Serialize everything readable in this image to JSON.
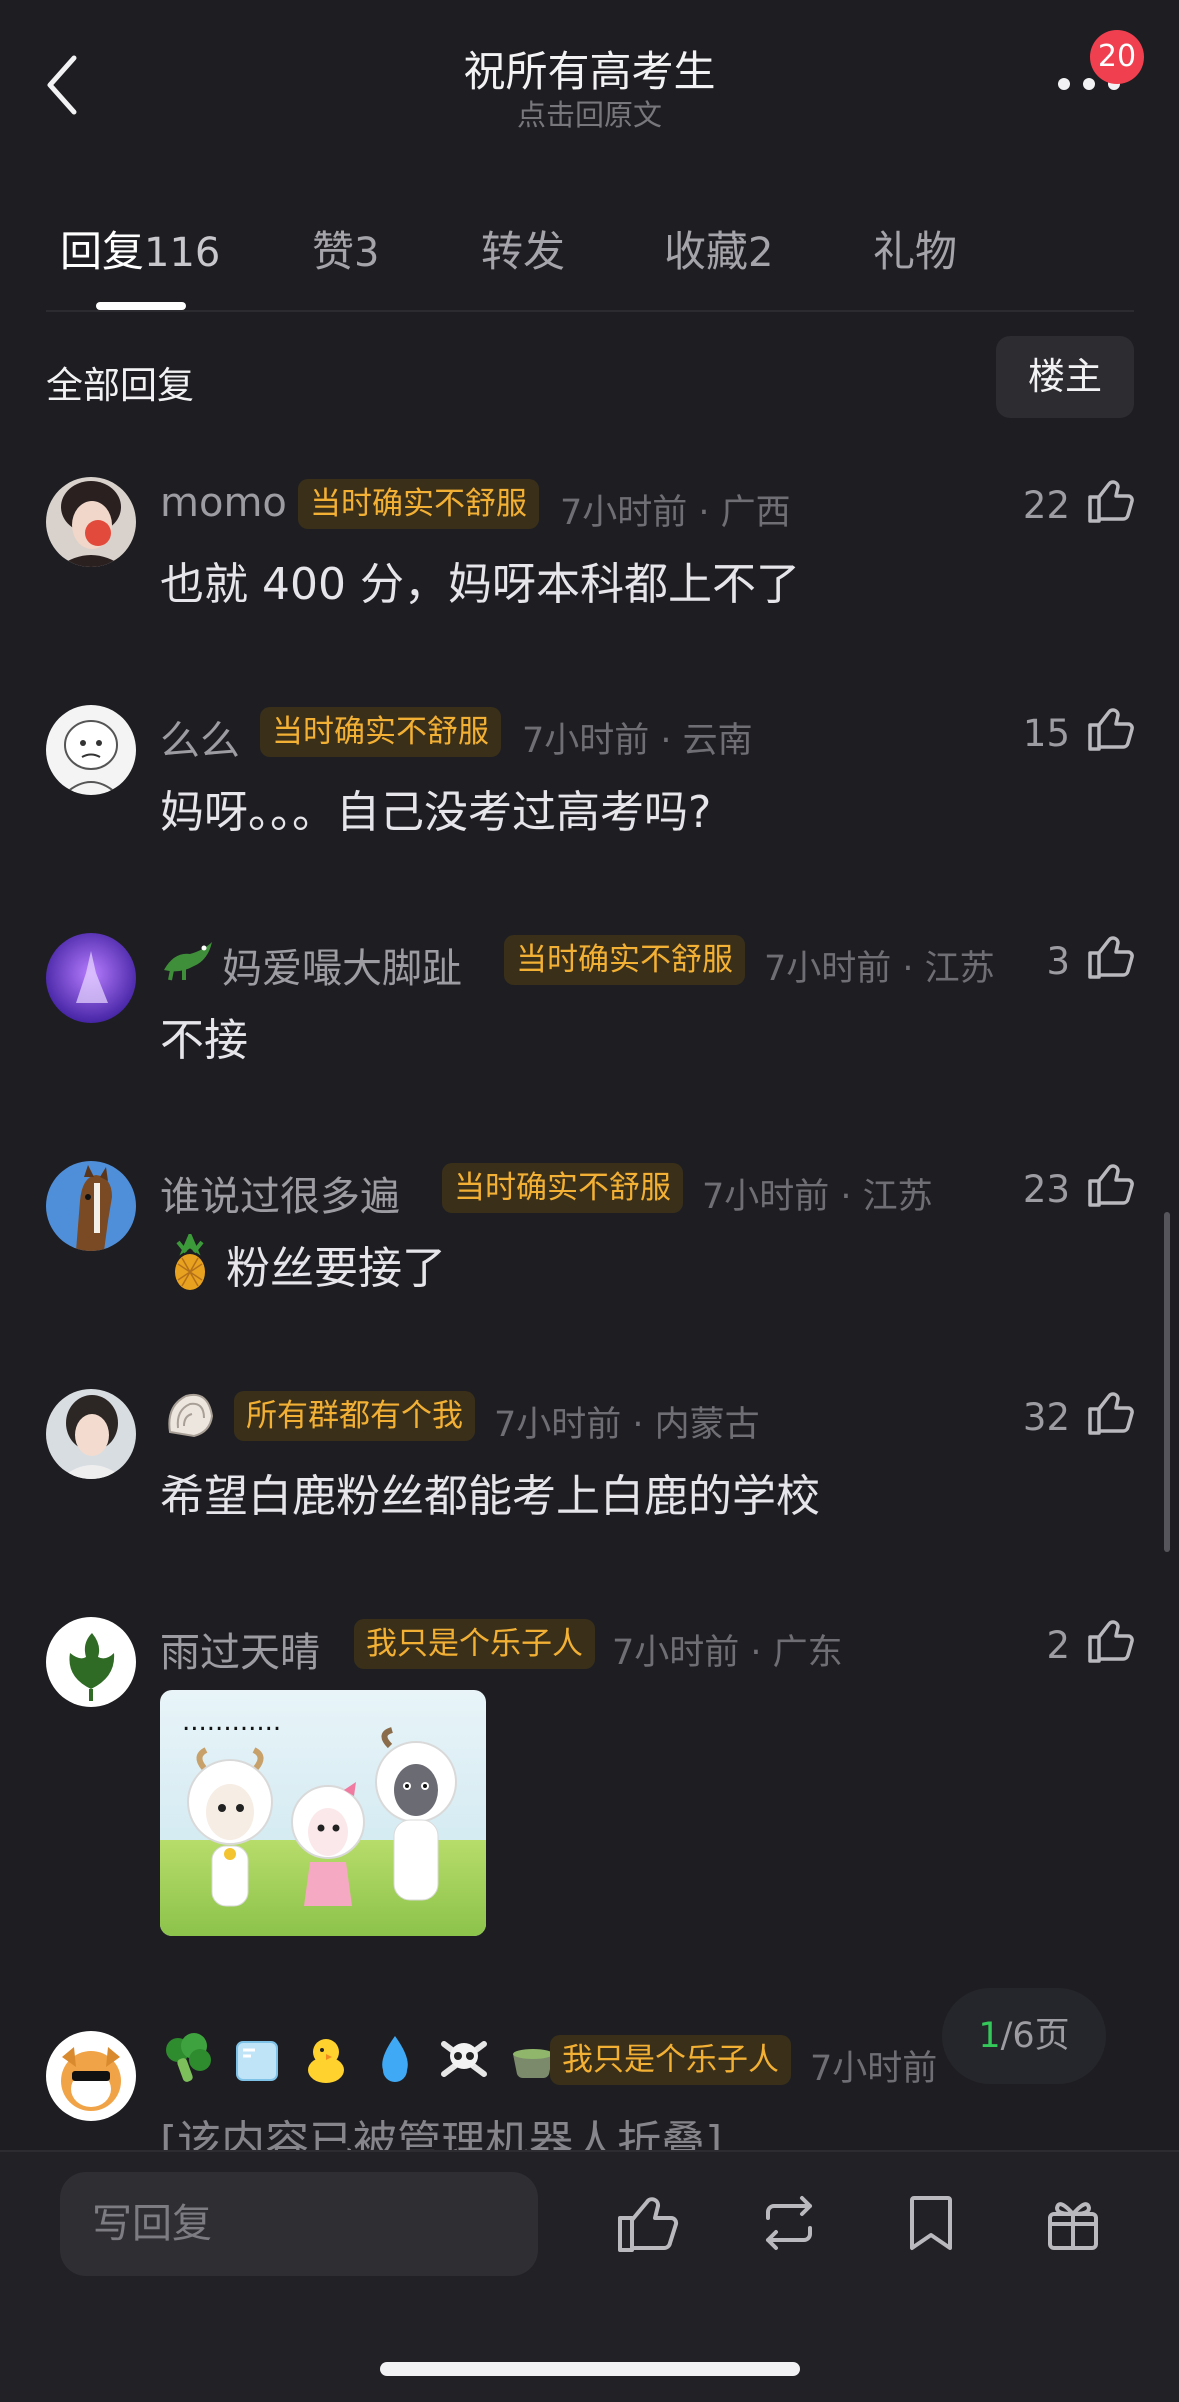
{
  "header": {
    "title": "祝所有高考生",
    "subtitle": "点击回原文",
    "badge_count": "20"
  },
  "tabs": [
    {
      "label": "回复",
      "count": "116",
      "active": true
    },
    {
      "label": "赞",
      "count": "3"
    },
    {
      "label": "转发",
      "count": ""
    },
    {
      "label": "收藏",
      "count": "2"
    },
    {
      "label": "礼物",
      "count": ""
    }
  ],
  "section": {
    "title": "全部回复",
    "filter": "楼主"
  },
  "comments": [
    {
      "username": "momo",
      "tag": "当时确实不舒服",
      "time": "7小时前 · 广西",
      "likes": "22",
      "text": "也就 400 分，妈呀本科都上不了"
    },
    {
      "username": "么么",
      "tag": "当时确实不舒服",
      "time": "7小时前 · 云南",
      "likes": "15",
      "text": "妈呀。。。自己没考过高考吗?"
    },
    {
      "username": "妈爱嘬大脚趾",
      "tag": "当时确实不舒服",
      "time": "7小时前 · 江苏",
      "likes": "3",
      "text": "不接"
    },
    {
      "username": "谁说过很多遍",
      "tag": "当时确实不舒服",
      "time": "7小时前 · 江苏",
      "likes": "23",
      "text": "粉丝要接了"
    },
    {
      "username": "",
      "tag": "所有群都有个我",
      "time": "7小时前 · 内蒙古",
      "likes": "32",
      "text": "希望白鹿粉丝都能考上白鹿的学校"
    },
    {
      "username": "雨过天晴",
      "tag": "我只是个乐子人",
      "time": "7小时前 · 广东",
      "likes": "2",
      "text": ""
    },
    {
      "username": "",
      "tag": "我只是个乐子人",
      "time": "7小时前",
      "likes": "",
      "text": "[该内容已被管理机器人折叠]"
    }
  ],
  "meme_image_text": "............",
  "pager": {
    "current": "1",
    "total": "/6页"
  },
  "bottom": {
    "reply_placeholder": "写回复"
  },
  "colors": {
    "background": "#1e1e22",
    "tag_text": "#f2b034",
    "tag_bg": "#3a2f19",
    "badge": "#f0404f",
    "pager_current": "#34c759"
  },
  "icons": [
    "back-icon",
    "more-icon",
    "like-icon",
    "retweet-icon",
    "bookmark-icon",
    "gift-icon"
  ]
}
